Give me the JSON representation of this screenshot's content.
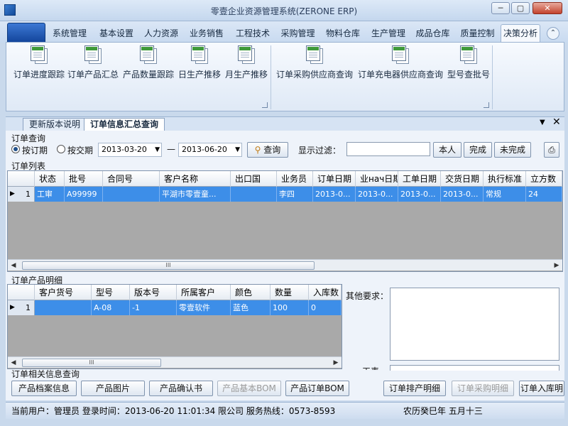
{
  "window": {
    "title": "零壹企业资源管理系统(ZERONE ERP)",
    "min_label": "─",
    "max_label": "▢",
    "close_label": "✕"
  },
  "menu": {
    "tabs": [
      "系统管理",
      "基本设置",
      "人力资源",
      "业务销售",
      "工程技术",
      "采购管理",
      "物料仓库",
      "生产管理",
      "成品仓库",
      "质量控制",
      "决策分析"
    ],
    "active": "决策分析",
    "collapse_label": "⌃"
  },
  "ribbon": {
    "buttons": [
      "订单进度跟踪",
      "订单产品汇总",
      "产品数量跟踪",
      "日生产推移",
      "月生产推移",
      "订单采购供应商查询",
      "订单充电器供应商查询",
      "型号查批号"
    ]
  },
  "doc_tabs": {
    "items": [
      "更新版本说明",
      "订单信息汇总查询"
    ],
    "active": "订单信息汇总查询",
    "dropdown_label": "▼",
    "close_label": "✕"
  },
  "query": {
    "group_label": "订单查询",
    "radio1": "按订期",
    "radio2": "按交期",
    "selected": "按订期",
    "date_from": "2013-03-20",
    "dash": "—",
    "date_to": "2013-06-20",
    "search_label": "查询",
    "filter_label": "显示过滤：",
    "filter_value": "",
    "btn_self": "本人",
    "btn_done": "完成",
    "btn_undone": "未完成"
  },
  "order_list": {
    "label": "订单列表",
    "columns": [
      "状态",
      "批号",
      "合同号",
      "客户名称",
      "出口国",
      "业务员",
      "订单日期",
      "业нач日期",
      "工单日期",
      "交货日期",
      "执行标准",
      "立方数"
    ],
    "rows": [
      {
        "index": "1",
        "cells": [
          "工审",
          "A99999",
          "",
          "平湖市零壹童...",
          "",
          "李四",
          "2013-0...",
          "2013-0...",
          "2013-0...",
          "2013-0...",
          "常规",
          "24"
        ]
      }
    ]
  },
  "product_detail": {
    "label": "订单产品明细",
    "columns": [
      "客户货号",
      "型号",
      "版本号",
      "所属客户",
      "颜色",
      "数量",
      "入库数"
    ],
    "rows": [
      {
        "index": "1",
        "cells": [
          "",
          "A-08",
          "-1",
          "零壹软件",
          "蓝色",
          "100",
          "0"
        ]
      }
    ],
    "other_req_label": "其他要求：",
    "craft_label": "工表"
  },
  "related": {
    "label": "订单相关信息查询",
    "buttons": [
      {
        "label": "产品档案信息",
        "enabled": true
      },
      {
        "label": "产品图片",
        "enabled": true
      },
      {
        "label": "产品确认书",
        "enabled": true
      },
      {
        "label": "产品基本BOM",
        "enabled": false
      },
      {
        "label": "产品订单BOM",
        "enabled": true
      },
      {
        "label": "订单排产明细",
        "enabled": true
      },
      {
        "label": "订单采购明细",
        "enabled": false
      },
      {
        "label": "订单入库明",
        "enabled": true
      }
    ]
  },
  "status": {
    "user": "当前用户：管理员  登录时间：2013-06-20 11:01:34",
    "company": "限公司 服务热线：0573-8593",
    "lunar": "农历癸巳年 五月十三"
  },
  "scroll_glyph": "III",
  "colors": {
    "accent": "#3d8ee8",
    "brand": "#12449a",
    "chrome": "#c9d9ec"
  }
}
